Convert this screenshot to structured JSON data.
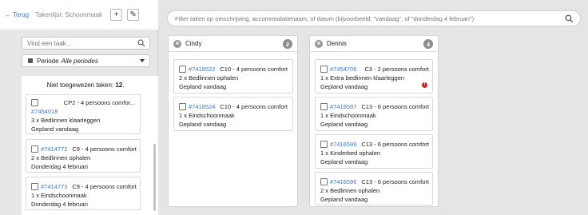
{
  "left": {
    "back_label": "Terug",
    "takenlijst_label": "Takenlijst: Schoonmaak",
    "add_icon": "+",
    "edit_icon": "✎",
    "search_placeholder": "Vind een taak...",
    "periode_label": "Periode",
    "periode_value": "Alle periodes",
    "unassigned_label": "Niet toegewezen taken:",
    "unassigned_count": "12",
    "cards": [
      {
        "id": "#7454018",
        "room": "CP2 - 4 persoons comfor...",
        "task": "3 x Bedlinnen klaarleggen",
        "date": "Gepland vandaag"
      },
      {
        "id": "#7414772",
        "room": "C9 - 4 persoons comfort",
        "task": "2 x Bedlinnen ophalen",
        "date": "Donderdag 4 februari"
      },
      {
        "id": "#7414773",
        "room": "C9 - 4 persoons comfort",
        "task": "1 x Eindschoonmaak",
        "date": "Donderdag 4 februari"
      }
    ]
  },
  "filter": {
    "placeholder": "Filter taken op omschrijving, accommodatienaam, of datum (bijvoorbeeld: \"vandaag\", of \"donderdag 4 februari\")"
  },
  "columns": [
    {
      "name": "Cindy",
      "count": "2",
      "cards": [
        {
          "id": "#7418522",
          "room": "C10 - 4 persoons comfort",
          "task": "2 x Bedlinnen ophalen",
          "date": "Gepland vandaag"
        },
        {
          "id": "#7418524",
          "room": "C10 - 4 persoons comfort",
          "task": "1 x Eindschoonmaak",
          "date": "Gepland vandaag"
        }
      ]
    },
    {
      "name": "Dennis",
      "count": "4",
      "cards": [
        {
          "id": "#7454706",
          "room": "C3 - 2 persoons comfort",
          "task": "1 x Extra bedlinnen klaarleggen",
          "date": "Gepland vandaag",
          "warning": "!"
        },
        {
          "id": "#7416597",
          "room": "C13 - 6 persoons comfort",
          "task": "1 x Eindschoonmaak",
          "date": "Gepland vandaag"
        },
        {
          "id": "#7416599",
          "room": "C13 - 6 persoons comfort",
          "task": "1 x Kinderbed ophalen",
          "date": "Gepland vandaag"
        },
        {
          "id": "#7416596",
          "room": "C13 - 6 persoons comfort",
          "task": "2 x Bedlinnen ophalen",
          "date": "Gepland vandaag"
        }
      ]
    }
  ],
  "colors": {
    "link": "#3b78c9",
    "badge": "#8c8c8c",
    "warning": "#c62828",
    "background": "#e4e5e7"
  },
  "icons": {
    "search": "search-icon",
    "calendar": "calendar-icon",
    "avatar": "avatar-icon"
  }
}
